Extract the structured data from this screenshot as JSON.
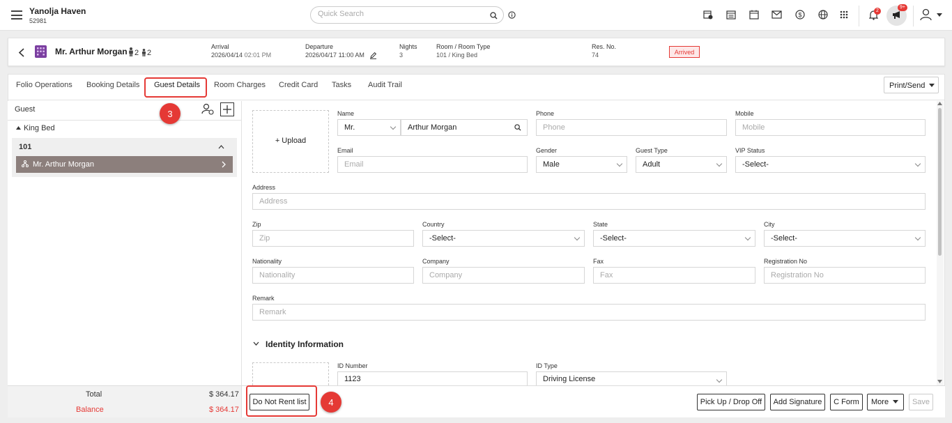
{
  "header": {
    "hotel_name": "Yanolja Haven",
    "hotel_code": "52981",
    "search_placeholder": "Quick Search",
    "notifications_count": "2",
    "announcements_count": "9+"
  },
  "reservation": {
    "guest_name": "Mr. Arthur Morgan",
    "adults": "2",
    "children": "2",
    "arrival_label": "Arrival",
    "arrival_value": "2026/04/14",
    "arrival_time": "02:01 PM",
    "departure_label": "Departure",
    "departure_value": "2026/04/17",
    "departure_time": "11:00 AM",
    "nights_label": "Nights",
    "nights_value": "3",
    "room_label": "Room / Room Type",
    "room_value": "101 / King Bed",
    "resno_label": "Res. No.",
    "resno_value": "74",
    "status": "Arrived"
  },
  "tabs": [
    "Folio Operations",
    "Booking Details",
    "Guest Details",
    "Room Charges",
    "Credit Card",
    "Tasks",
    "Audit Trail"
  ],
  "print_send": "Print/Send",
  "left_panel": {
    "title": "Guest",
    "room_type": "King Bed",
    "room_number": "101",
    "guest": "Mr. Arthur Morgan",
    "total_label": "Total",
    "total_value": "$ 364.17",
    "balance_label": "Balance",
    "balance_value": "$ 364.17"
  },
  "markers": {
    "guest_details": "3",
    "do_not_rent": "4"
  },
  "form": {
    "upload": "+ Upload",
    "name_label": "Name",
    "salutation": "Mr.",
    "name_value": "Arthur Morgan",
    "phone_label": "Phone",
    "phone_placeholder": "Phone",
    "mobile_label": "Mobile",
    "mobile_placeholder": "Mobile",
    "email_label": "Email",
    "email_placeholder": "Email",
    "gender_label": "Gender",
    "gender_value": "Male",
    "guest_type_label": "Guest Type",
    "guest_type_value": "Adult",
    "vip_label": "VIP Status",
    "vip_value": "-Select-",
    "address_label": "Address",
    "address_placeholder": "Address",
    "zip_label": "Zip",
    "zip_placeholder": "Zip",
    "country_label": "Country",
    "country_value": "-Select-",
    "state_label": "State",
    "state_value": "-Select-",
    "city_label": "City",
    "city_value": "-Select-",
    "nationality_label": "Nationality",
    "nationality_placeholder": "Nationality",
    "company_label": "Company",
    "company_placeholder": "Company",
    "fax_label": "Fax",
    "fax_placeholder": "Fax",
    "regno_label": "Registration No",
    "regno_placeholder": "Registration No",
    "remark_label": "Remark",
    "remark_placeholder": "Remark",
    "identity_title": "Identity Information",
    "id_number_label": "ID Number",
    "id_number_value": "1123",
    "id_type_label": "ID Type",
    "id_type_value": "Driving License"
  },
  "footer": {
    "do_not_rent": "Do Not Rent list",
    "pickup": "Pick Up / Drop Off",
    "signature": "Add Signature",
    "cform": "C Form",
    "more": "More",
    "save": "Save"
  }
}
